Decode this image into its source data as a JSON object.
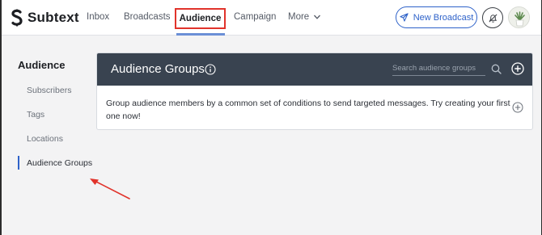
{
  "brand": {
    "name": "Subtext"
  },
  "nav": {
    "items": [
      {
        "label": "Inbox"
      },
      {
        "label": "Broadcasts"
      },
      {
        "label": "Audience"
      },
      {
        "label": "Campaign"
      },
      {
        "label": "More"
      }
    ],
    "active": "Audience",
    "new_broadcast_label": "New Broadcast"
  },
  "sidebar": {
    "title": "Audience",
    "items": [
      {
        "label": "Subscribers"
      },
      {
        "label": "Tags"
      },
      {
        "label": "Locations"
      },
      {
        "label": "Audience Groups"
      }
    ],
    "selected": "Audience Groups"
  },
  "card": {
    "title": "Audience Groups",
    "search_placeholder": "Search audience groups",
    "empty_message": "Group audience members by a common set of conditions to send targeted messages. Try creating your first one now!"
  },
  "icons": [
    "logo-icon",
    "chevron-down-icon",
    "send-icon",
    "bell-off-icon",
    "avatar-plant-icon",
    "info-icon",
    "search-icon",
    "add-circle-icon"
  ],
  "colors": {
    "accent": "#2e62c9",
    "header_bg": "#394350",
    "highlight_box": "#e1332b",
    "annotation_arrow": "#e1332b"
  }
}
